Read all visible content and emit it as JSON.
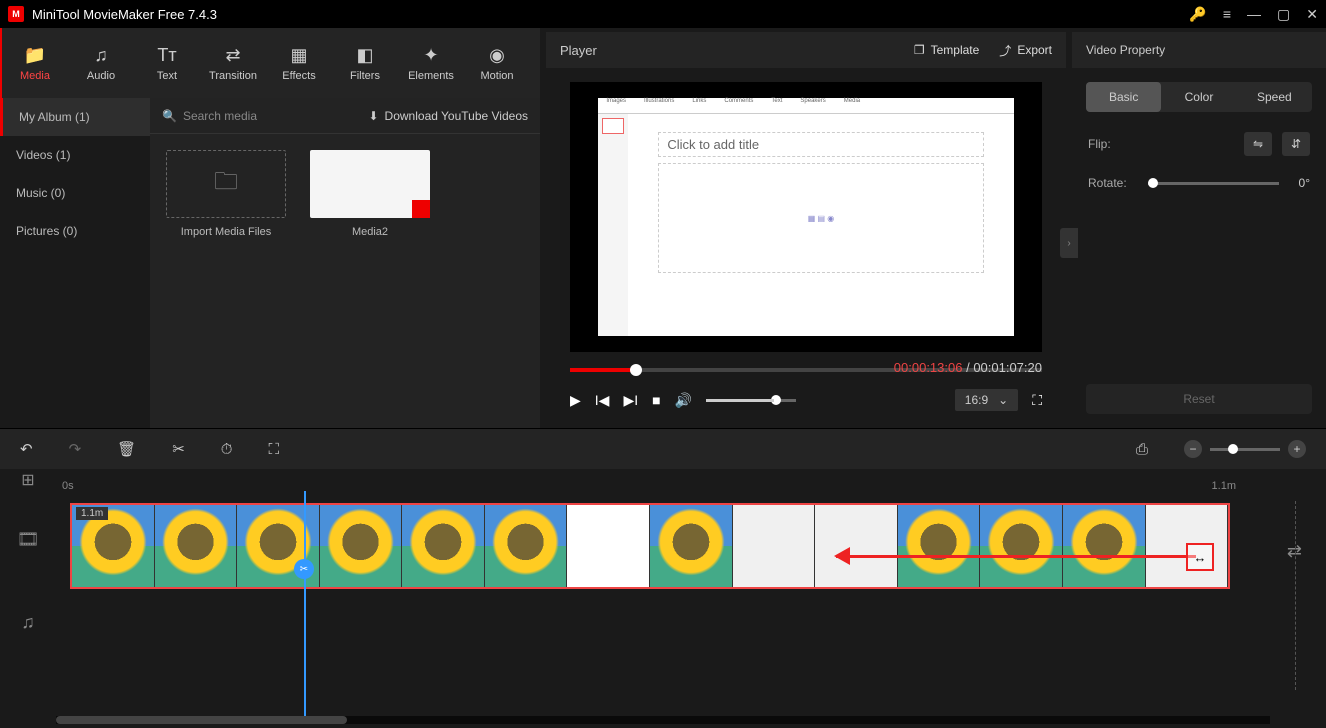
{
  "titlebar": {
    "app_title": "MiniTool MovieMaker Free 7.4.3"
  },
  "toolbar": {
    "items": [
      {
        "label": "Media",
        "icon": "📁"
      },
      {
        "label": "Audio",
        "icon": "♫"
      },
      {
        "label": "Text",
        "icon": "Tᴛ"
      },
      {
        "label": "Transition",
        "icon": "⇄"
      },
      {
        "label": "Effects",
        "icon": "▦"
      },
      {
        "label": "Filters",
        "icon": "◧"
      },
      {
        "label": "Elements",
        "icon": "✦"
      },
      {
        "label": "Motion",
        "icon": "◉"
      }
    ]
  },
  "media_sidebar": {
    "items": [
      {
        "label": "My Album (1)"
      },
      {
        "label": "Videos (1)"
      },
      {
        "label": "Music (0)"
      },
      {
        "label": "Pictures (0)"
      }
    ]
  },
  "media_header": {
    "search_placeholder": "Search media",
    "download_label": "Download YouTube Videos"
  },
  "media_grid": {
    "import_label": "Import Media Files",
    "item1_label": "Media2"
  },
  "player": {
    "title": "Player",
    "template_label": "Template",
    "export_label": "Export",
    "slide_title": "Click to add title",
    "time_current": "00:00:13:06",
    "time_sep": " / ",
    "time_total": "00:01:07:20",
    "aspect": "16:9"
  },
  "props": {
    "title": "Video Property",
    "tabs": {
      "basic": "Basic",
      "color": "Color",
      "speed": "Speed"
    },
    "flip_label": "Flip:",
    "rotate_label": "Rotate:",
    "rotate_value": "0°",
    "reset": "Reset"
  },
  "timeline": {
    "ruler_start": "0s",
    "ruler_end": "1.1m",
    "clip_duration": "1.1m"
  }
}
